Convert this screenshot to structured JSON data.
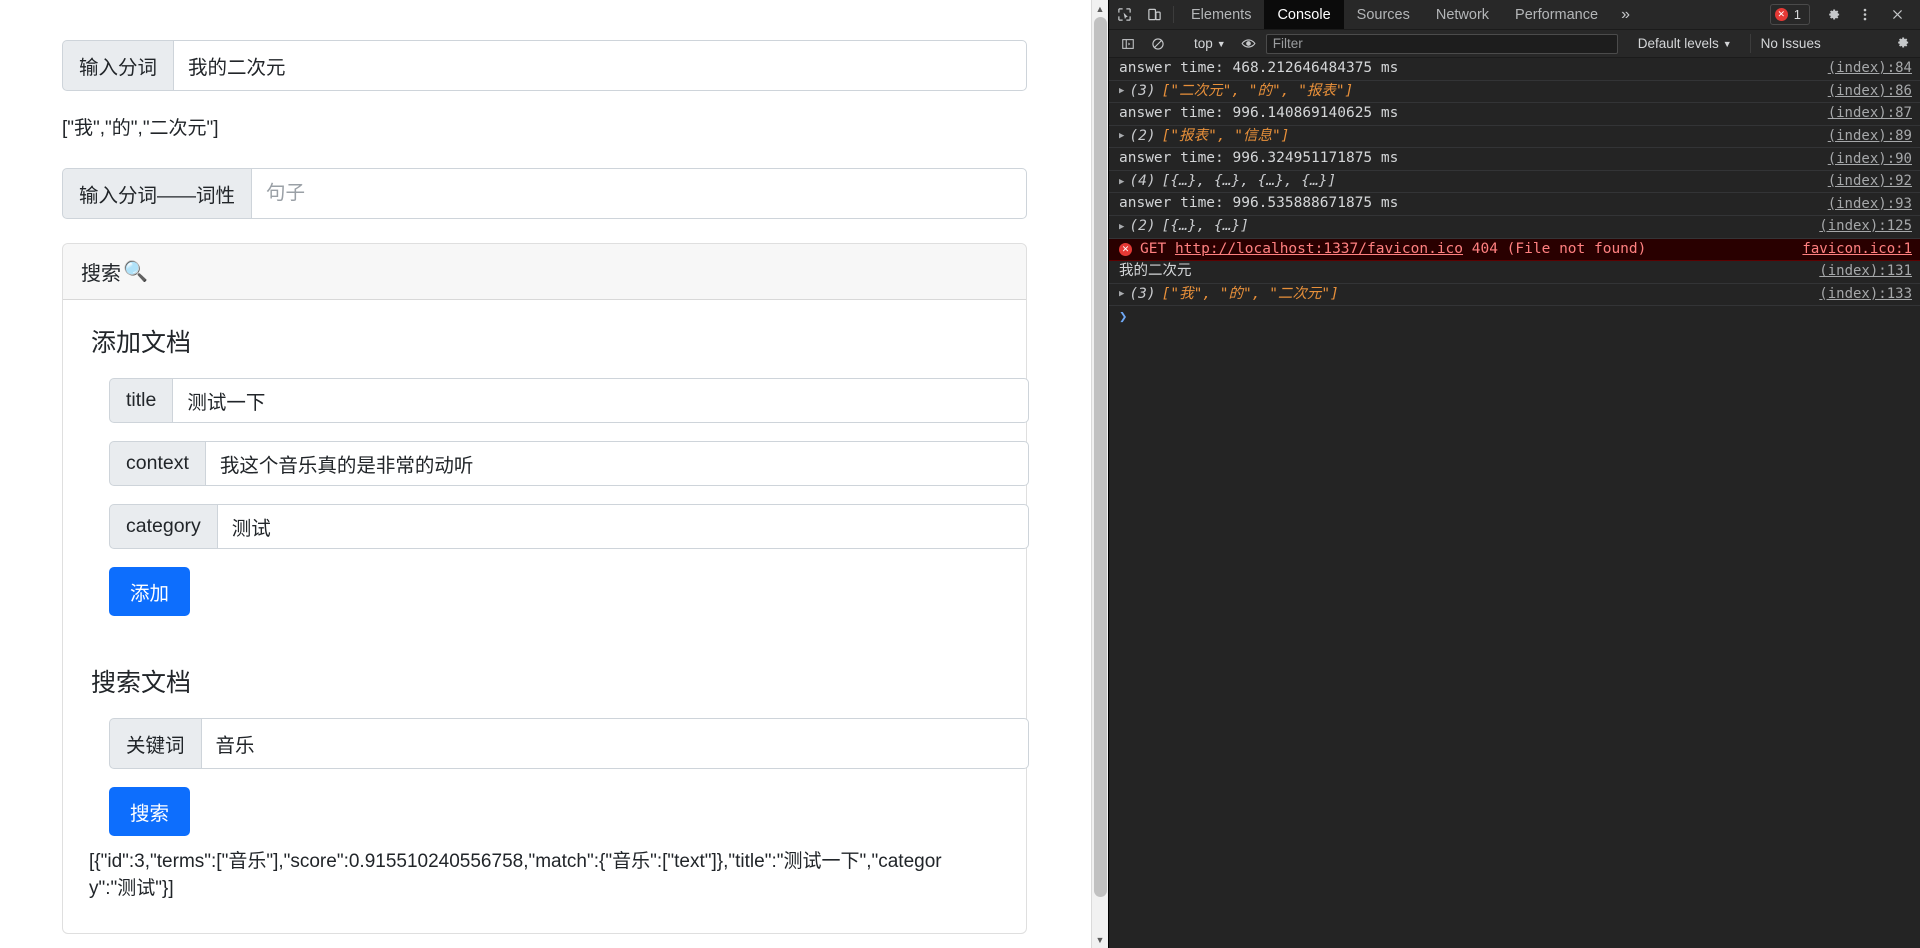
{
  "page": {
    "segment_input": {
      "label": "输入分词",
      "value": "我的二次元",
      "placeholder": "句子"
    },
    "tokens_output": "[\"我\",\"的\",\"二次元\"]",
    "pos_input": {
      "label": "输入分词——词性",
      "value": "",
      "placeholder": "句子"
    },
    "card": {
      "header": "搜索",
      "header_icon": "magnifier-emoji",
      "add_section": {
        "title": "添加文档",
        "fields": [
          {
            "label": "title",
            "value": "测试一下",
            "placeholder": "title"
          },
          {
            "label": "context",
            "value": "我这个音乐真的是非常的动听",
            "placeholder": "context"
          },
          {
            "label": "category",
            "value": "测试",
            "placeholder": "category"
          }
        ],
        "button": "添加"
      },
      "search_section": {
        "title": "搜索文档",
        "field": {
          "label": "关键词",
          "value": "音乐",
          "placeholder": "关键词"
        },
        "button": "搜索",
        "result": "[{\"id\":3,\"terms\":[\"音乐\"],\"score\":0.915510240556758,\"match\":{\"音乐\":[\"text\"]},\"title\":\"测试一下\",\"category\":\"测试\"}]"
      }
    }
  },
  "devtools": {
    "tabs": [
      {
        "label": "Elements",
        "active": false
      },
      {
        "label": "Console",
        "active": true
      },
      {
        "label": "Sources",
        "active": false
      },
      {
        "label": "Network",
        "active": false
      },
      {
        "label": "Performance",
        "active": false
      }
    ],
    "more_tabs_glyph": "»",
    "error_badge_count": "1",
    "toolbar_icons": [
      "inspect-element-icon",
      "device-toolbar-icon",
      "error-badge",
      "settings-gear-icon",
      "kebab-menu-icon",
      "close-icon"
    ],
    "filterbar": {
      "sidebar_toggle": "console-sidebar-icon",
      "clear": "clear-console-icon",
      "context": "top",
      "eye": "live-expression-icon",
      "filter_placeholder": "Filter",
      "filter_value": "",
      "levels": "Default levels",
      "issues": "No Issues",
      "settings": "settings-gear-icon"
    },
    "logs": [
      {
        "type": "text",
        "text": "answer time: 468.212646484375 ms",
        "source": "(index):84"
      },
      {
        "type": "array",
        "count": "(3)",
        "body": "[\"二次元\", \"的\", \"报表\"]",
        "source": "(index):86"
      },
      {
        "type": "text",
        "text": "answer time: 996.140869140625 ms",
        "source": "(index):87"
      },
      {
        "type": "array",
        "count": "(2)",
        "body": "[\"报表\", \"信息\"]",
        "source": "(index):89"
      },
      {
        "type": "text",
        "text": "answer time: 996.324951171875 ms",
        "source": "(index):90"
      },
      {
        "type": "objarray",
        "count": "(4)",
        "body": "[{…}, {…}, {…}, {…}]",
        "source": "(index):92"
      },
      {
        "type": "text",
        "text": "answer time: 996.535888671875 ms",
        "source": "(index):93"
      },
      {
        "type": "objarray",
        "count": "(2)",
        "body": "[{…}, {…}]",
        "source": "(index):125"
      },
      {
        "type": "error",
        "method": "GET",
        "url": "http://localhost:1337/favicon.ico",
        "status": "404 (File not found)",
        "source": "favicon.ico:1"
      },
      {
        "type": "text",
        "text": "我的二次元",
        "source": "(index):131"
      },
      {
        "type": "array",
        "count": "(3)",
        "body": "[\"我\", \"的\", \"二次元\"]",
        "source": "(index):133"
      }
    ]
  },
  "colors": {
    "accent_blue": "#0d6efd",
    "error_red": "#e53935",
    "console_bg": "#242424",
    "tab_active_bg": "#0b0b0b",
    "string_orange": "#e8903a"
  }
}
